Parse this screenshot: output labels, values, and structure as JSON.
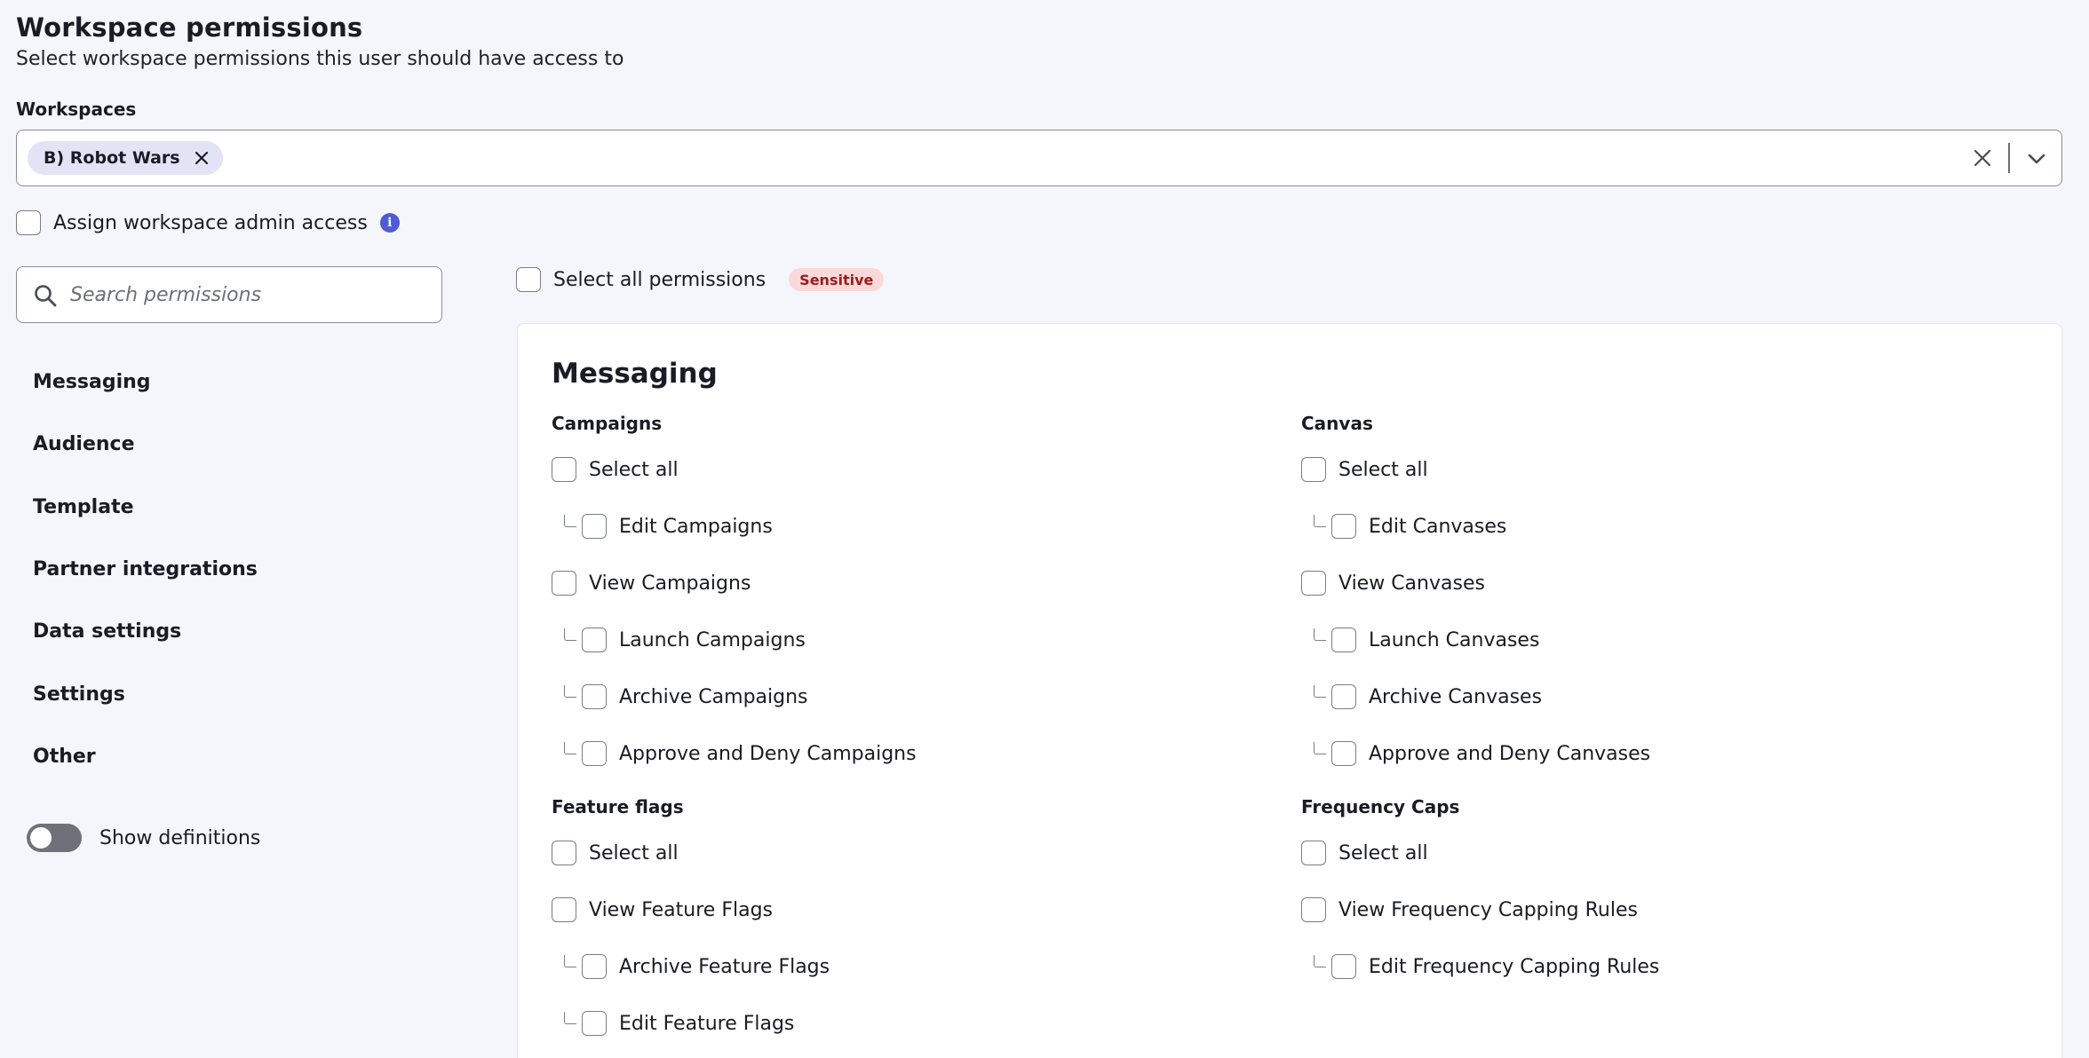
{
  "header": {
    "title": "Workspace permissions",
    "subtitle": "Select workspace permissions this user should have access to"
  },
  "workspaces": {
    "label": "Workspaces",
    "selected": [
      "B) Robot Wars"
    ]
  },
  "admin_access": {
    "label": "Assign workspace admin access"
  },
  "search": {
    "placeholder": "Search permissions",
    "value": ""
  },
  "sidebar": {
    "items": [
      {
        "label": "Messaging"
      },
      {
        "label": "Audience"
      },
      {
        "label": "Template"
      },
      {
        "label": "Partner integrations"
      },
      {
        "label": "Data settings"
      },
      {
        "label": "Settings"
      },
      {
        "label": "Other"
      }
    ],
    "show_definitions": {
      "label": "Show definitions",
      "on": false
    }
  },
  "select_all_permissions": {
    "label": "Select all permissions",
    "badge": "Sensitive"
  },
  "section": {
    "title": "Messaging",
    "groups": [
      {
        "title": "Campaigns",
        "items": [
          {
            "label": "Select all",
            "child": false
          },
          {
            "label": "Edit Campaigns",
            "child": true
          },
          {
            "label": "View Campaigns",
            "child": false
          },
          {
            "label": "Launch Campaigns",
            "child": true
          },
          {
            "label": "Archive Campaigns",
            "child": true
          },
          {
            "label": "Approve and Deny Campaigns",
            "child": true
          }
        ]
      },
      {
        "title": "Canvas",
        "items": [
          {
            "label": "Select all",
            "child": false
          },
          {
            "label": "Edit Canvases",
            "child": true
          },
          {
            "label": "View Canvases",
            "child": false
          },
          {
            "label": "Launch Canvases",
            "child": true
          },
          {
            "label": "Archive Canvases",
            "child": true
          },
          {
            "label": "Approve and Deny Canvases",
            "child": true
          }
        ]
      },
      {
        "title": "Feature flags",
        "items": [
          {
            "label": "Select all",
            "child": false
          },
          {
            "label": "View Feature Flags",
            "child": false
          },
          {
            "label": "Archive Feature Flags",
            "child": true
          },
          {
            "label": "Edit Feature Flags",
            "child": true
          }
        ]
      },
      {
        "title": "Frequency Caps",
        "items": [
          {
            "label": "Select all",
            "child": false
          },
          {
            "label": "View Frequency Capping Rules",
            "child": false
          },
          {
            "label": "Edit Frequency Capping Rules",
            "child": true
          }
        ]
      }
    ]
  }
}
